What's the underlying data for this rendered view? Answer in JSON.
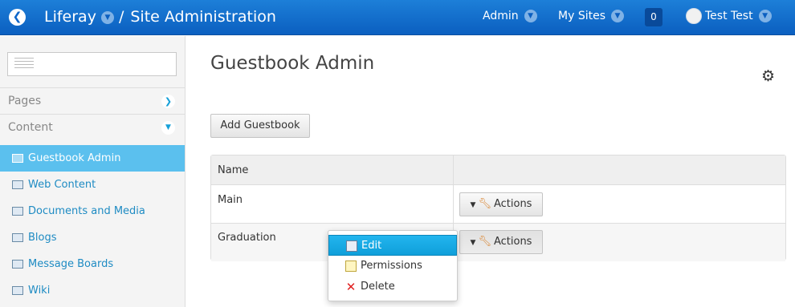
{
  "topbar": {
    "back_icon": "back-arrow-icon",
    "brand": "Liferay",
    "separator": "/",
    "title": "Site Administration",
    "admin": "Admin",
    "my_sites": "My Sites",
    "notifications": "0",
    "user": "Test Test",
    "bar_color": "#0e6bd0"
  },
  "sidebar": {
    "search_placeholder": "",
    "sections": [
      {
        "label": "Pages",
        "state": "collapsed"
      },
      {
        "label": "Content",
        "state": "expanded"
      }
    ],
    "items": [
      {
        "label": "Guestbook Admin",
        "active": true
      },
      {
        "label": "Web Content",
        "active": false
      },
      {
        "label": "Documents and Media",
        "active": false
      },
      {
        "label": "Blogs",
        "active": false
      },
      {
        "label": "Message Boards",
        "active": false
      },
      {
        "label": "Wiki",
        "active": false
      }
    ],
    "active_color": "#5bc0ee"
  },
  "main": {
    "title": "Guestbook Admin",
    "add_button": "Add Guestbook",
    "table": {
      "header": "Name",
      "rows": [
        {
          "name": "Main",
          "action": "Actions"
        },
        {
          "name": "Graduation",
          "action": "Actions"
        }
      ]
    },
    "dropdown": {
      "items": [
        {
          "label": "Edit",
          "icon": "edit-icon",
          "highlighted": true
        },
        {
          "label": "Permissions",
          "icon": "permissions-icon",
          "highlighted": false
        },
        {
          "label": "Delete",
          "icon": "delete-icon",
          "highlighted": false
        }
      ]
    }
  }
}
